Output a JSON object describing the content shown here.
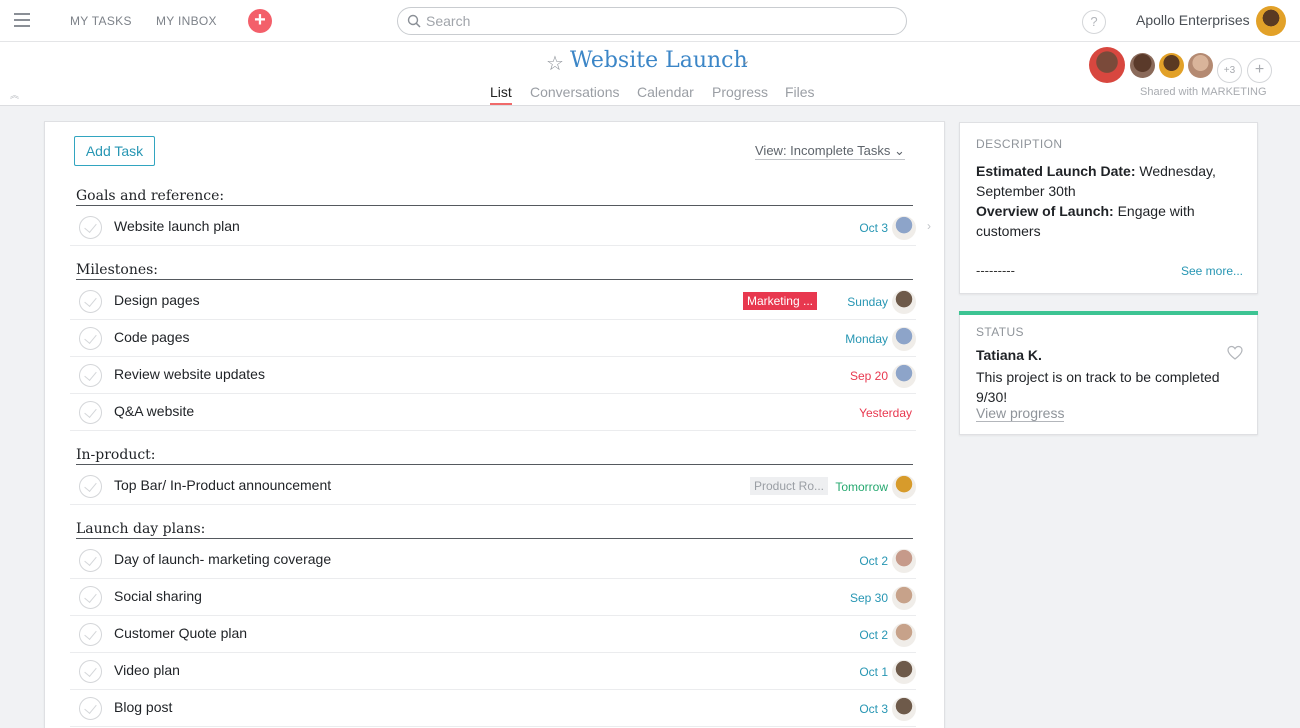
{
  "topbar": {
    "my_tasks": "MY TASKS",
    "my_inbox": "MY INBOX",
    "search_placeholder": "Search",
    "help": "?",
    "org_name": "Apollo Enterprises"
  },
  "project": {
    "title": "Website Launch",
    "tabs": [
      "List",
      "Conversations",
      "Calendar",
      "Progress",
      "Files"
    ],
    "active_tab": "List",
    "extra_members": "+3",
    "add_member": "+",
    "shared_with": "Shared with MARKETING"
  },
  "list": {
    "add_task_label": "Add Task",
    "view_label": "View: Incomplete Tasks",
    "sections": [
      {
        "title": "Goals and reference:",
        "tasks": [
          {
            "name": "Website launch plan",
            "due": "Oct 3",
            "due_color": "#2796b3",
            "tag": "",
            "avatar": "#8da4c9"
          }
        ]
      },
      {
        "title": "Milestones:",
        "tasks": [
          {
            "name": "Design pages",
            "due": "Sunday",
            "due_color": "#2796b3",
            "tag": "Marketing ...",
            "tag_style": "red",
            "avatar": "#6e5a4a"
          },
          {
            "name": "Code pages",
            "due": "Monday",
            "due_color": "#2796b3",
            "tag": "",
            "avatar": "#8da4c9"
          },
          {
            "name": "Review website updates",
            "due": "Sep 20",
            "due_color": "#e8384f",
            "tag": "",
            "avatar": "#8da4c9"
          },
          {
            "name": "Q&A website",
            "due": "Yesterday",
            "due_color": "#e8384f",
            "tag": "",
            "avatar": ""
          }
        ]
      },
      {
        "title": "In-product:",
        "tasks": [
          {
            "name": "Top Bar/ In-Product announcement",
            "due": "Tomorrow",
            "due_color": "#25a86f",
            "tag": "Product Ro...",
            "tag_style": "grey",
            "avatar": "#d79b2b"
          }
        ]
      },
      {
        "title": "Launch day plans:",
        "tasks": [
          {
            "name": "Day of launch- marketing coverage",
            "due": "Oct 2",
            "due_color": "#2796b3",
            "tag": "",
            "avatar": "#c69a8a"
          },
          {
            "name": "Social sharing",
            "due": "Sep 30",
            "due_color": "#2796b3",
            "tag": "",
            "avatar": "#c7a28a"
          },
          {
            "name": "Customer Quote plan",
            "due": "Oct 2",
            "due_color": "#2796b3",
            "tag": "",
            "avatar": "#c7a28a"
          },
          {
            "name": "Video plan",
            "due": "Oct 1",
            "due_color": "#2796b3",
            "tag": "",
            "avatar": "#6e5a4a"
          },
          {
            "name": "Blog post",
            "due": "Oct 3",
            "due_color": "#2796b3",
            "tag": "",
            "avatar": "#6e5a4a"
          }
        ]
      }
    ]
  },
  "description": {
    "label": "DESCRIPTION",
    "date_label": "Estimated Launch Date:",
    "date_value": "Wednesday, September 30th",
    "overview_label": "Overview of Launch:",
    "overview_value": "Engage with customers",
    "dashes": "---------",
    "see_more": "See more..."
  },
  "status": {
    "label": "STATUS",
    "author": "Tatiana K.",
    "text": "This project is on track to be completed 9/30!",
    "link": "View progress"
  },
  "colors": {
    "accent": "#2796b3",
    "title_blue": "#3c86c7",
    "overdue": "#e8384f",
    "tomorrow": "#25a86f",
    "status_green": "#3dc493",
    "add_button": "#f35f6a"
  }
}
